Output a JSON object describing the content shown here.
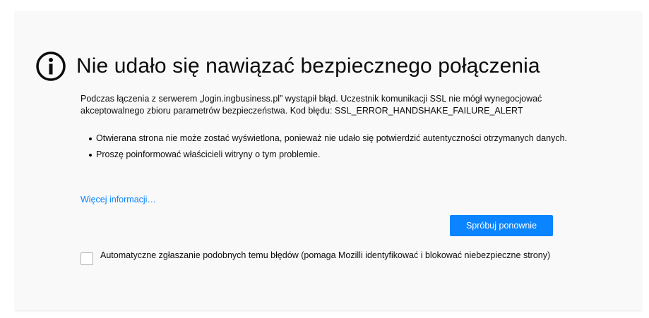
{
  "error_page": {
    "icon": "info-icon",
    "title": "Nie udało się nawiązać bezpiecznego połączenia",
    "description": "Podczas łączenia z serwerem „login.ingbusiness.pl” wystąpił błąd. Uczestnik komunikacji SSL nie mógł wynegocjować akceptowalnego zbioru parametrów bezpieczeństwa. Kod błędu: SSL_ERROR_HANDSHAKE_FAILURE_ALERT",
    "bullets": [
      "Otwierana strona nie może zostać wyświetlona, ponieważ nie udało się potwierdzić autentyczności otrzymanych danych.",
      "Proszę poinformować właścicieli witryny o tym problemie."
    ],
    "more_info_link": "Więcej informacji…",
    "retry_button": "Spróbuj ponownie",
    "report_checkbox": {
      "checked": false,
      "label": "Automatyczne zgłaszanie podobnych temu błędów (pomaga Mozilli identyfikować i blokować niebezpieczne strony)"
    }
  },
  "colors": {
    "background": "#f9f9fa",
    "text": "#0c0c0d",
    "accent": "#0a84ff"
  }
}
